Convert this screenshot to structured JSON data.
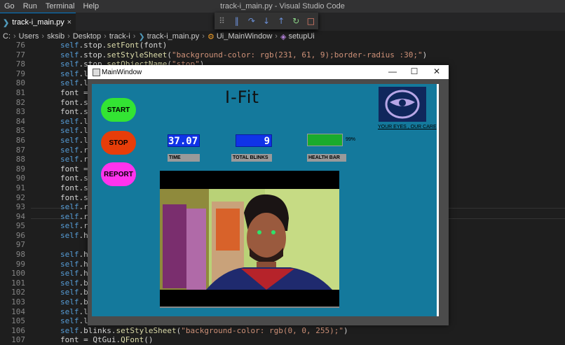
{
  "menu": [
    "Go",
    "Run",
    "Terminal",
    "Help"
  ],
  "vscode_title": "track-i_main.py - Visual Studio Code",
  "tab": {
    "icon_text": "❯",
    "label": "track-i_main.py",
    "close": "×"
  },
  "breadcrumbs": [
    "C:",
    "Users",
    "sksib",
    "Desktop",
    "track-i",
    "track-i_main.py",
    "Ui_MainWindow",
    "setupUi"
  ],
  "line_numbers": [
    "76",
    "77",
    "78",
    "79",
    "80",
    "81",
    "82",
    "83",
    "84",
    "85",
    "86",
    "87",
    "88",
    "89",
    "90",
    "91",
    "92",
    "93",
    "94",
    "95",
    "96",
    "97",
    "98",
    "99",
    "100",
    "101",
    "102",
    "103",
    "104",
    "105",
    "106",
    "107"
  ],
  "code_lines": [
    "self.stop.setFont(font)",
    "self.stop.setStyleSheet(\"background-color: rgb(231, 61, 9);border-radius :30;\")",
    "self.stop.setObjectName(\"stop\")",
    "self.lab",
    "self.lab",
    "font = Q",
    "font.set",
    "font.set",
    "self.lab",
    "self.lab",
    "self.lab",
    "self.rep",
    "self.rep",
    "font = Q",
    "font.set",
    "font.set",
    "font.set",
    "self.rep",
    "self.rep",
    "self.rep",
    "self.hea",
    "",
    "self.hea",
    "self.hea",
    "self.hea",
    "self.bli",
    "self.bli",
    "self.bli",
    "self.lab",
    "self.lab",
    "self.blinks.setStyleSheet(\"background-color: rgb(0, 0, 255);\")",
    "font = QtGui.QFont()"
  ],
  "qt_window": {
    "title": "MainWindow",
    "minimize": "—",
    "maximize": "☐",
    "close": "✕"
  },
  "app": {
    "name": "I-Fit",
    "buttons": {
      "start": {
        "label": "START",
        "color": "#33e433"
      },
      "stop": {
        "label": "STOP",
        "color": "#e73d09"
      },
      "report": {
        "label": "REPORT",
        "color": "#ff33ee"
      }
    },
    "time_value": "37.07",
    "blinks_value": "9",
    "health_percent": 99,
    "health_text": "99%",
    "labels": {
      "time": "TIME",
      "blinks": "TOTAL BLINKS",
      "health": "HEALTH BAR"
    },
    "logo_caption": "YOUR EYES , OUR CARE"
  },
  "colors": {
    "canvas_bg": "#14799c",
    "lcd_bg": "#1033e8",
    "health_fill": "#1aab2c"
  }
}
